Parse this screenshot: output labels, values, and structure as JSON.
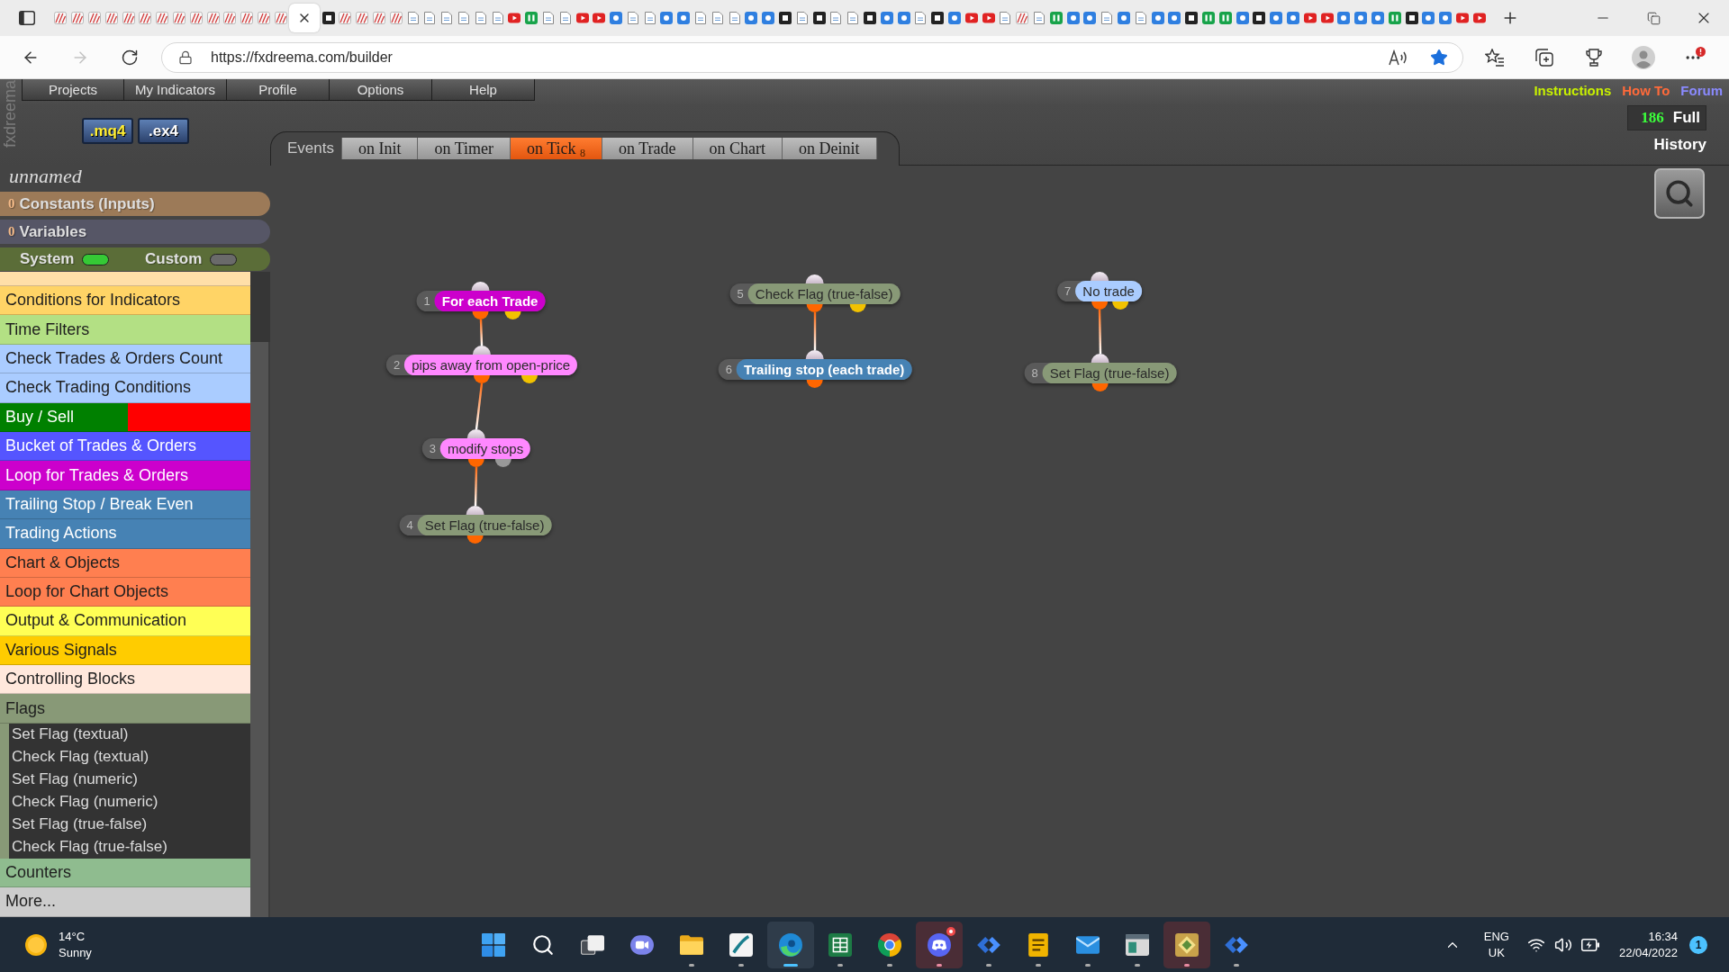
{
  "browser": {
    "tabs": [
      {
        "kind": "striped",
        "selected": false
      },
      {
        "kind": "striped",
        "selected": false
      },
      {
        "kind": "striped",
        "selected": false
      },
      {
        "kind": "striped",
        "selected": false
      },
      {
        "kind": "striped",
        "selected": false
      },
      {
        "kind": "striped",
        "selected": false
      },
      {
        "kind": "striped",
        "selected": false
      },
      {
        "kind": "striped",
        "selected": false
      },
      {
        "kind": "striped",
        "selected": false
      },
      {
        "kind": "striped",
        "selected": false
      },
      {
        "kind": "striped",
        "selected": false
      },
      {
        "kind": "striped",
        "selected": false
      },
      {
        "kind": "striped",
        "selected": false
      },
      {
        "kind": "striped",
        "selected": false
      },
      {
        "selected": true
      },
      {
        "kind": "dark",
        "selected": false
      },
      {
        "kind": "striped",
        "selected": false
      },
      {
        "kind": "striped",
        "selected": false
      },
      {
        "kind": "striped",
        "selected": false
      },
      {
        "kind": "striped",
        "selected": false
      },
      {
        "kind": "page",
        "selected": false
      },
      {
        "kind": "page",
        "selected": false
      },
      {
        "kind": "page",
        "selected": false
      },
      {
        "kind": "page",
        "selected": false
      },
      {
        "kind": "page",
        "selected": false
      },
      {
        "kind": "page",
        "selected": false
      },
      {
        "kind": "play",
        "selected": false
      },
      {
        "kind": "bars",
        "selected": false
      },
      {
        "kind": "page",
        "selected": false
      },
      {
        "kind": "page",
        "selected": false
      },
      {
        "kind": "play",
        "selected": false
      },
      {
        "kind": "play",
        "selected": false
      },
      {
        "kind": "dot",
        "selected": false
      },
      {
        "kind": "page",
        "selected": false
      },
      {
        "kind": "page",
        "selected": false
      },
      {
        "kind": "dot",
        "selected": false
      },
      {
        "kind": "dot",
        "selected": false
      },
      {
        "kind": "page",
        "selected": false
      },
      {
        "kind": "page",
        "selected": false
      },
      {
        "kind": "page",
        "selected": false
      },
      {
        "kind": "dot",
        "selected": false
      },
      {
        "kind": "dot",
        "selected": false
      },
      {
        "kind": "dark",
        "selected": false
      },
      {
        "kind": "page",
        "selected": false
      },
      {
        "kind": "dark",
        "selected": false
      },
      {
        "kind": "page",
        "selected": false
      },
      {
        "kind": "page",
        "selected": false
      },
      {
        "kind": "dark",
        "selected": false
      },
      {
        "kind": "dot",
        "selected": false
      },
      {
        "kind": "dot",
        "selected": false
      },
      {
        "kind": "page",
        "selected": false
      },
      {
        "kind": "dark",
        "selected": false
      },
      {
        "kind": "dot",
        "selected": false
      },
      {
        "kind": "play",
        "selected": false
      },
      {
        "kind": "play",
        "selected": false
      },
      {
        "kind": "page",
        "selected": false
      },
      {
        "kind": "striped",
        "selected": false
      },
      {
        "kind": "page",
        "selected": false
      },
      {
        "kind": "bars",
        "selected": false
      },
      {
        "kind": "dot",
        "selected": false
      },
      {
        "kind": "dot",
        "selected": false
      },
      {
        "kind": "page",
        "selected": false
      },
      {
        "kind": "dot",
        "selected": false
      },
      {
        "kind": "page",
        "selected": false
      },
      {
        "kind": "dot",
        "selected": false
      },
      {
        "kind": "dot",
        "selected": false
      },
      {
        "kind": "dark",
        "selected": false
      },
      {
        "kind": "bars",
        "selected": false
      },
      {
        "kind": "bars",
        "selected": false
      },
      {
        "kind": "dot",
        "selected": false
      },
      {
        "kind": "dark",
        "selected": false
      },
      {
        "kind": "dot",
        "selected": false
      },
      {
        "kind": "dot",
        "selected": false
      },
      {
        "kind": "play",
        "selected": false
      },
      {
        "kind": "play",
        "selected": false
      },
      {
        "kind": "dot",
        "selected": false
      },
      {
        "kind": "dot",
        "selected": false
      },
      {
        "kind": "dot",
        "selected": false
      },
      {
        "kind": "bars",
        "selected": false
      },
      {
        "kind": "dark",
        "selected": false
      },
      {
        "kind": "dot",
        "selected": false
      },
      {
        "kind": "dot",
        "selected": false
      },
      {
        "kind": "play",
        "selected": false
      },
      {
        "kind": "play",
        "selected": false
      }
    ],
    "nav": [
      {
        "kind": "back",
        "disabled": false
      },
      {
        "kind": "forward",
        "disabled": true
      },
      {
        "kind": "refresh",
        "disabled": false
      }
    ],
    "url": "https://fxdreema.com/builder",
    "favorite": true,
    "menu_alert": true
  },
  "app": {
    "brand": "fxdreema",
    "menu": [
      "Projects",
      "My Indicators",
      "Profile",
      "Options",
      "Help"
    ],
    "links": [
      {
        "label": "Instructions",
        "color": "#c8f000"
      },
      {
        "label": "How To",
        "color": "#ff6a3a"
      },
      {
        "label": "Forum",
        "color": "#8a8aff"
      }
    ],
    "file_buttons": [
      {
        "label": ".mq4",
        "color": "#ffee33"
      },
      {
        "label": ".ex4",
        "color": "#ffffff"
      }
    ],
    "events": {
      "label": "Events",
      "tabs": [
        {
          "label": "on Init",
          "selected": false
        },
        {
          "label": "on Timer",
          "selected": false
        },
        {
          "label": "on Tick",
          "count": "8",
          "selected": true
        },
        {
          "label": "on Trade",
          "selected": false
        },
        {
          "label": "on Chart",
          "selected": false
        },
        {
          "label": "on Deinit",
          "selected": false
        }
      ]
    },
    "credits": {
      "count": "186",
      "plan": "Full"
    },
    "history": "History"
  },
  "sidebar": {
    "project_name": "unnamed",
    "sections": [
      {
        "count": "0",
        "label": "Constants (Inputs)",
        "color": "#9c7a58"
      },
      {
        "count": "0",
        "label": "Variables",
        "color": "#565666"
      }
    ],
    "toggles": [
      {
        "label": "System",
        "on": true
      },
      {
        "label": "Custom",
        "on": false
      }
    ],
    "categories": [
      {
        "label": "Conditions for Indicators",
        "color": "#ffd466",
        "expanded": false
      },
      {
        "label": "Time Filters",
        "color": "#b3e084",
        "expanded": false
      },
      {
        "label": "Check Trades & Orders Count",
        "color": "#aaccff",
        "expanded": false
      },
      {
        "label": "Check Trading Conditions",
        "color": "#aaccff",
        "expanded": false
      },
      {
        "label": "Buy / Sell",
        "color": "#008000",
        "split": {
          "color": "#ff0000"
        },
        "expanded": false
      },
      {
        "label": "Bucket of Trades & Orders",
        "color": "#5555ff",
        "expanded": false
      },
      {
        "label": "Loop for Trades & Orders",
        "color": "#cc00cc",
        "expanded": false
      },
      {
        "label": "Trailing Stop / Break Even",
        "color": "#4682b4",
        "expanded": false
      },
      {
        "label": "Trading Actions",
        "color": "#4682b4",
        "expanded": false
      },
      {
        "label": "Chart & Objects",
        "color": "#ff7f50",
        "expanded": false
      },
      {
        "label": "Loop for Chart Objects",
        "color": "#ff7f50",
        "expanded": false
      },
      {
        "label": "Output & Communication",
        "color": "#ffff55",
        "expanded": false
      },
      {
        "label": "Various Signals",
        "color": "#ffcc00",
        "expanded": false
      },
      {
        "label": "Controlling Blocks",
        "color": "#ffe8dc",
        "expanded": false
      },
      {
        "label": "Flags",
        "color": "#889977",
        "expanded": true,
        "children": [
          {
            "label": "Set Flag (textual)"
          },
          {
            "label": "Check Flag (textual)"
          },
          {
            "label": "Set Flag (numeric)"
          },
          {
            "label": "Check Flag (numeric)"
          },
          {
            "label": "Set Flag (true-false)"
          },
          {
            "label": "Check Flag (true-false)"
          }
        ]
      },
      {
        "label": "Counters",
        "color": "#8fbc8f",
        "expanded": false
      },
      {
        "label": "More...",
        "color": "#cccccc",
        "expanded": false
      }
    ]
  },
  "canvas": {
    "chains": [
      {
        "blocks": [
          {
            "number": "1",
            "label": "For each Trade",
            "color": "#cc00cc",
            "outputs": [
              {
                "color": "#ff6600"
              },
              {
                "color": "#f2c200"
              }
            ]
          },
          {
            "number": "2",
            "label": "pips away from open-price",
            "color": "#ff88ff",
            "outputs": [
              {
                "color": "#ff6600"
              },
              {
                "color": "#f2c200"
              }
            ]
          },
          {
            "number": "3",
            "label": "modify stops",
            "color": "#ff88ff",
            "outputs": [
              {
                "color": "#ff6600"
              },
              {
                "color": "#999999"
              }
            ]
          },
          {
            "number": "4",
            "label": "Set Flag (true-false)",
            "color": "#889977",
            "outputs": [
              {
                "color": "#ff6600"
              }
            ]
          }
        ]
      },
      {
        "blocks": [
          {
            "number": "5",
            "label": "Check Flag (true-false)",
            "color": "#889977",
            "outputs": [
              {
                "color": "#ff6600"
              },
              {
                "color": "#f2c200"
              }
            ]
          },
          {
            "number": "6",
            "label": "Trailing stop (each trade)",
            "color": "#4682b4",
            "outputs": [
              {
                "color": "#ff6600"
              }
            ]
          }
        ]
      },
      {
        "blocks": [
          {
            "number": "7",
            "label": "No trade",
            "color": "#aaccff",
            "outputs": [
              {
                "color": "#ff6600"
              },
              {
                "color": "#f2c200"
              }
            ]
          },
          {
            "number": "8",
            "label": "Set Flag (true-false)",
            "color": "#889977",
            "outputs": [
              {
                "color": "#ff6600"
              }
            ]
          }
        ]
      }
    ]
  },
  "taskbar": {
    "weather": {
      "temperature": "14°C",
      "condition": "Sunny"
    },
    "apps": [
      {
        "kind": "start",
        "running": false,
        "active": false,
        "flashing": false,
        "unread": false
      },
      {
        "kind": "search",
        "running": false,
        "active": false,
        "flashing": false,
        "unread": false
      },
      {
        "kind": "taskview",
        "running": false,
        "active": false,
        "flashing": false,
        "unread": false
      },
      {
        "kind": "chat",
        "running": false,
        "active": false,
        "flashing": false,
        "unread": false
      },
      {
        "kind": "folder",
        "running": true,
        "active": false,
        "flashing": false,
        "unread": false
      },
      {
        "kind": "chart",
        "running": true,
        "active": false,
        "flashing": false,
        "unread": false
      },
      {
        "kind": "browser",
        "running": true,
        "active": true,
        "flashing": false,
        "unread": false
      },
      {
        "kind": "spreadsheet",
        "running": true,
        "active": false,
        "flashing": false,
        "unread": false
      },
      {
        "kind": "globe",
        "running": true,
        "active": false,
        "flashing": false,
        "unread": false
      },
      {
        "kind": "gamepad",
        "running": true,
        "active": false,
        "flashing": true,
        "unread": true
      },
      {
        "kind": "chevrons",
        "running": true,
        "active": false,
        "flashing": false,
        "unread": false
      },
      {
        "kind": "document",
        "running": true,
        "active": false,
        "flashing": false,
        "unread": false
      },
      {
        "kind": "mail",
        "running": true,
        "active": false,
        "flashing": false,
        "unread": false
      },
      {
        "kind": "window",
        "running": true,
        "active": false,
        "flashing": false,
        "unread": false
      },
      {
        "kind": "diamond",
        "running": true,
        "active": false,
        "flashing": true,
        "unread": false
      },
      {
        "kind": "chevrons",
        "running": true,
        "active": false,
        "flashing": false,
        "unread": false
      }
    ],
    "tray": {
      "language": "ENG",
      "region": "UK"
    },
    "clock": {
      "time": "16:34",
      "date": "22/04/2022"
    },
    "notifications": "1"
  }
}
